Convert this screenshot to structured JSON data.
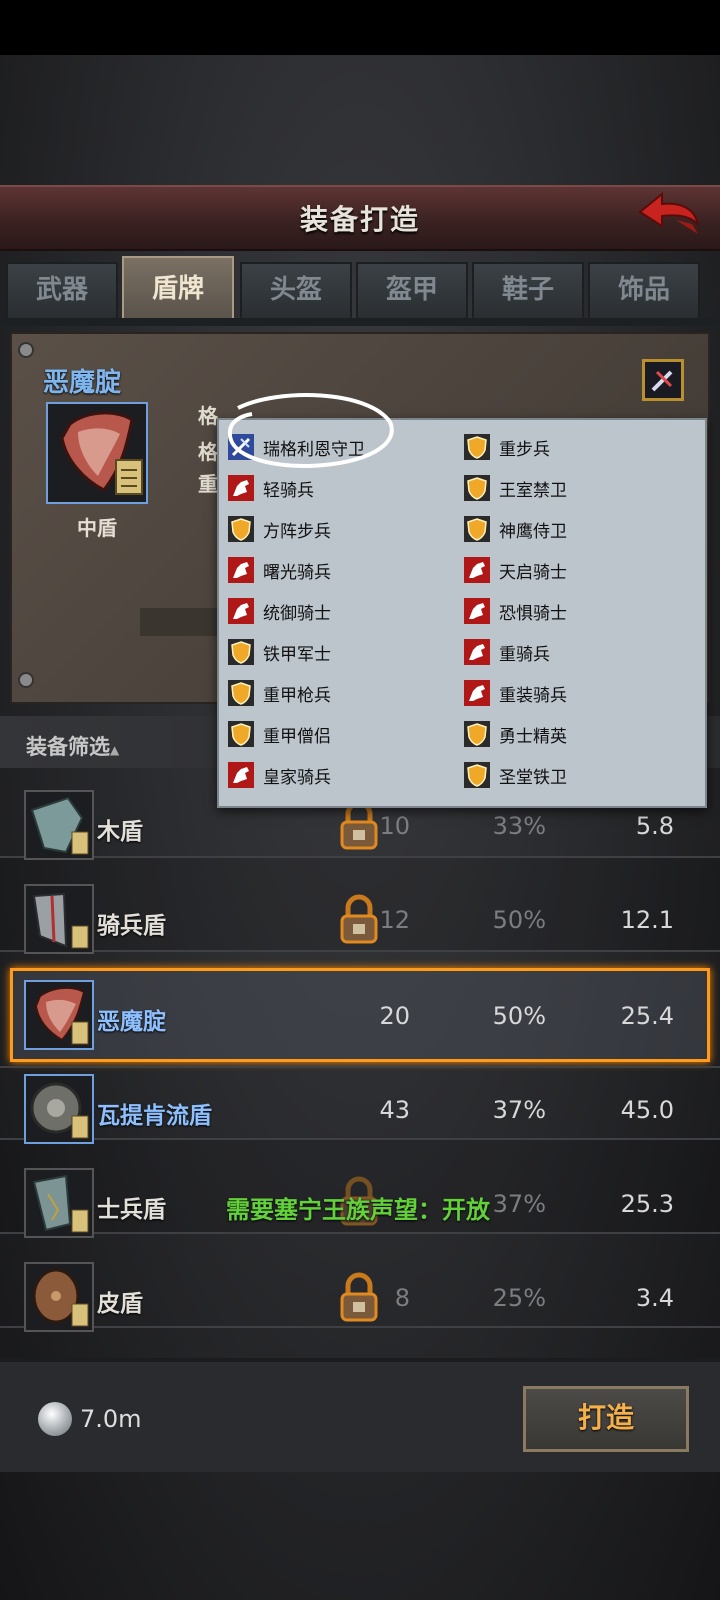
{
  "header": {
    "title": "装备打造"
  },
  "tabs": [
    {
      "label": "武器",
      "active": false
    },
    {
      "label": "盾牌",
      "active": true
    },
    {
      "label": "头盔",
      "active": false
    },
    {
      "label": "盔甲",
      "active": false
    },
    {
      "label": "鞋子",
      "active": false
    },
    {
      "label": "饰品",
      "active": false
    }
  ],
  "detail": {
    "name": "恶魔腚",
    "type": "中盾",
    "stat_prefix_1": "格",
    "stat_prefix_2": "格",
    "stat_prefix_3": "重"
  },
  "filter": {
    "label": "装备筛选"
  },
  "popup": {
    "left_col": [
      {
        "label": "瑞格利恩守卫",
        "icon": "sword-icon"
      },
      {
        "label": "轻骑兵",
        "icon": "horse-icon"
      },
      {
        "label": "方阵步兵",
        "icon": "shield-icon"
      },
      {
        "label": "曙光骑兵",
        "icon": "horse-icon"
      },
      {
        "label": "统御骑士",
        "icon": "horse-icon"
      },
      {
        "label": "铁甲军士",
        "icon": "shield-icon"
      },
      {
        "label": "重甲枪兵",
        "icon": "shield-icon"
      },
      {
        "label": "重甲僧侣",
        "icon": "shield-icon"
      },
      {
        "label": "皇家骑兵",
        "icon": "horse-icon"
      }
    ],
    "right_col": [
      {
        "label": "重步兵",
        "icon": "shield-icon"
      },
      {
        "label": "王室禁卫",
        "icon": "shield-icon"
      },
      {
        "label": "神鹰侍卫",
        "icon": "shield-icon"
      },
      {
        "label": "天启骑士",
        "icon": "horse-icon"
      },
      {
        "label": "恐惧骑士",
        "icon": "horse-icon"
      },
      {
        "label": "重骑兵",
        "icon": "horse-icon"
      },
      {
        "label": "重装骑兵",
        "icon": "horse-icon"
      },
      {
        "label": "勇士精英",
        "icon": "shield-icon"
      },
      {
        "label": "圣堂铁卫",
        "icon": "shield-icon"
      }
    ]
  },
  "items": [
    {
      "name": "木盾",
      "locked": true,
      "level": "10",
      "pct": "33%",
      "value": "5.8"
    },
    {
      "name": "骑兵盾",
      "locked": true,
      "level": "12",
      "pct": "50%",
      "value": "12.1"
    },
    {
      "name": "恶魔腚",
      "locked": false,
      "selected": true,
      "level": "20",
      "pct": "50%",
      "value": "25.4"
    },
    {
      "name": "瓦提肯流盾",
      "locked": false,
      "level": "43",
      "pct": "37%",
      "value": "45.0"
    },
    {
      "name": "士兵盾",
      "locked": true,
      "level": "",
      "pct": "37%",
      "value": "25.3",
      "note": "需要塞宁王族声望：开放"
    },
    {
      "name": "皮盾",
      "locked": true,
      "level": "8",
      "pct": "25%",
      "value": "3.4"
    }
  ],
  "footer": {
    "silver": "7.0m",
    "forge_label": "打造"
  },
  "colors": {
    "accent_orange": "#ff9a1a",
    "name_blue": "#8ec0ff",
    "note_green": "#63d13a",
    "forge_text": "#f5b04a"
  }
}
